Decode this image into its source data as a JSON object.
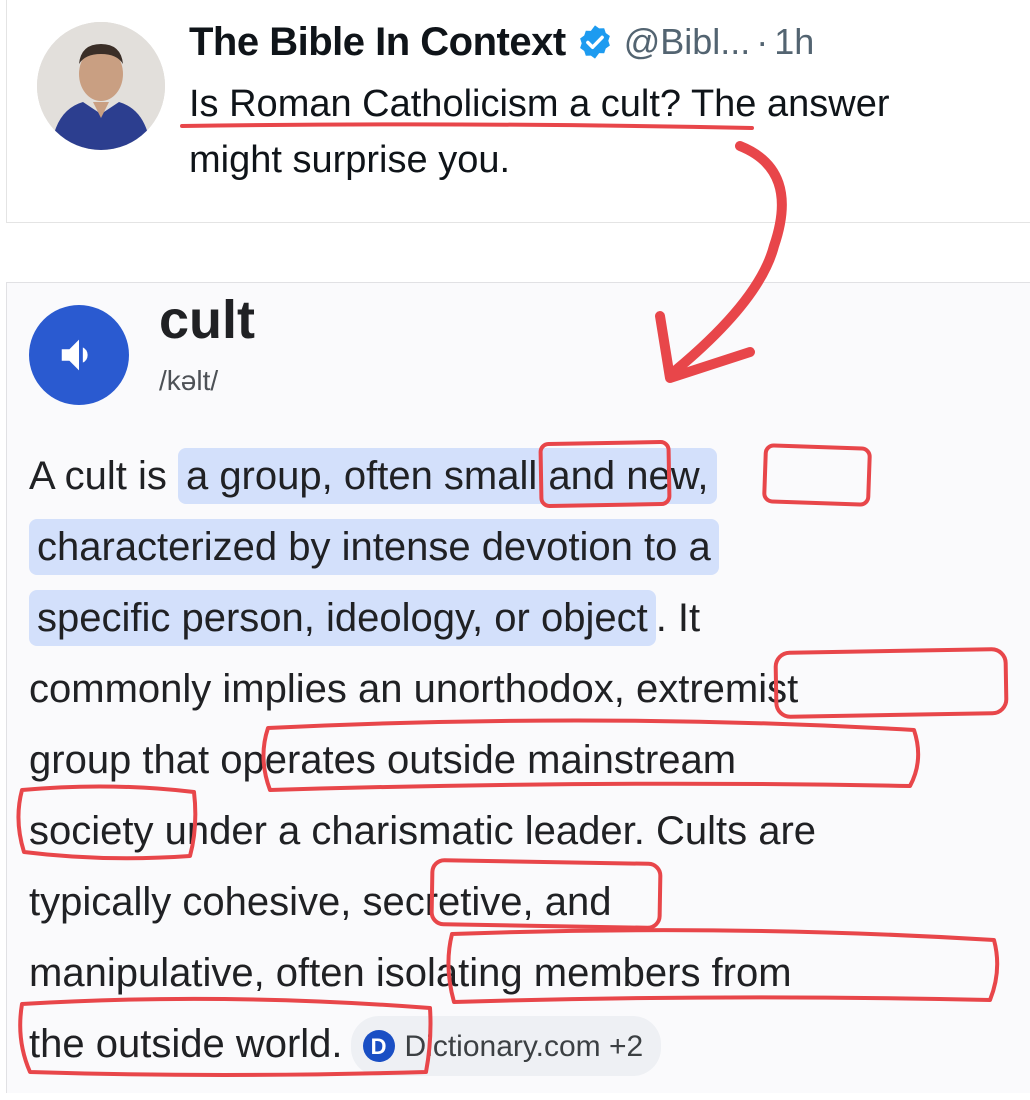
{
  "tweet": {
    "author_name": "The Bible In Context",
    "handle": "@Bibl...",
    "separator": "·",
    "time": "1h",
    "text_line1": "Is Roman Catholicism a cult? The answer",
    "text_line2": "might surprise you.",
    "verified_icon": "verified-badge-icon"
  },
  "dictionary": {
    "word": "cult",
    "pronunciation": "/kəlt/",
    "speaker_icon": "speaker-icon",
    "definition_lines": [
      {
        "pre": "A cult is ",
        "hl": "a group, often small and new,",
        "post": ""
      },
      {
        "pre": "",
        "hl": "characterized by intense devotion to a",
        "post": ""
      },
      {
        "pre": "",
        "hl": "specific person, ideology, or object",
        "post": ". It"
      },
      {
        "pre": "commonly implies an unorthodox, extremist",
        "hl": "",
        "post": ""
      },
      {
        "pre": "group that operates outside mainstream",
        "hl": "",
        "post": ""
      },
      {
        "pre": "society under a charismatic leader. Cults are",
        "hl": "",
        "post": ""
      },
      {
        "pre": "typically cohesive, secretive, and",
        "hl": "",
        "post": ""
      },
      {
        "pre": "manipulative, often isolating members from",
        "hl": "",
        "post": ""
      },
      {
        "pre": "the outside world.",
        "hl": "",
        "post": ""
      }
    ],
    "source_label": "Dictionary.com +2",
    "source_icon_letter": "D"
  },
  "colors": {
    "annotation_red": "#e8464a",
    "highlight_blue": "#d3e0fb",
    "speaker_blue": "#2a5ad0",
    "verified_blue": "#1d9bf0"
  }
}
